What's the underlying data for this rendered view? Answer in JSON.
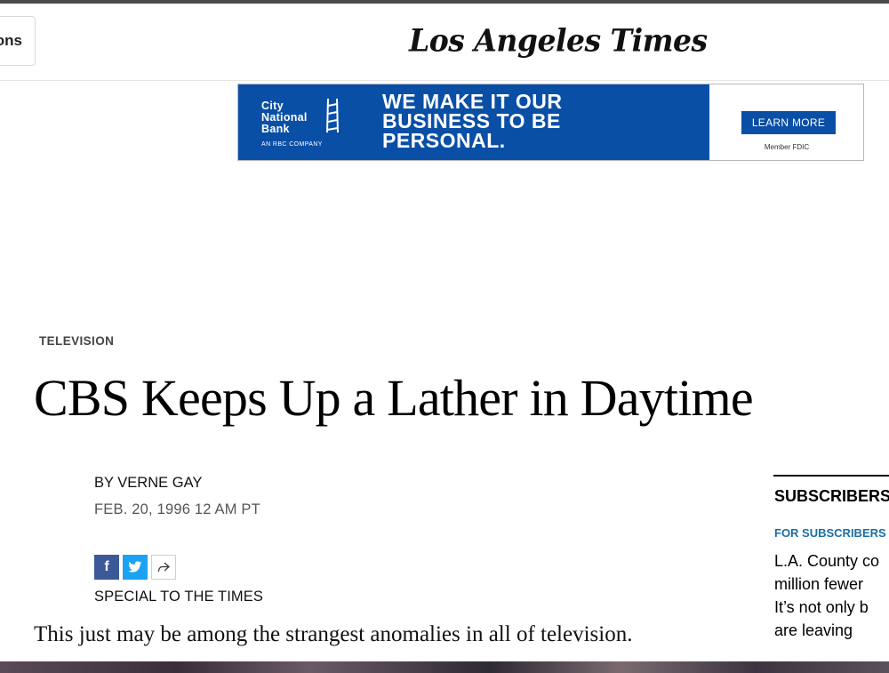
{
  "header": {
    "sections_label": "ons",
    "logo_text": "Los Angeles Times"
  },
  "ad": {
    "bank_lines": [
      "City",
      "National",
      "Bank"
    ],
    "bank_sub": "AN RBC COMPANY",
    "headline_lines": [
      "WE MAKE IT OUR",
      "BUSINESS TO BE",
      "PERSONAL."
    ],
    "cta": "LEARN MORE",
    "fdic": "Member FDIC",
    "accent": "#0a4fa6"
  },
  "article": {
    "kicker": "TELEVISION",
    "headline": "CBS Keeps Up a Lather in Daytime",
    "byline": "BY VERNE GAY",
    "date": "FEB. 20, 1996 12 AM PT",
    "special": "SPECIAL TO THE TIMES",
    "first_paragraph": "This just may be among the strangest anomalies in all of television."
  },
  "share": {
    "icons": [
      "facebook-icon",
      "twitter-icon",
      "share-icon"
    ],
    "facebook_color": "#3b5998",
    "twitter_color": "#1da1f2"
  },
  "sidebar": {
    "title": "SUBSCRIBERS",
    "kicker": "FOR SUBSCRIBERS",
    "story_lines": [
      "L.A. County co",
      "million fewer",
      "It’s not only b",
      "are leaving"
    ]
  }
}
